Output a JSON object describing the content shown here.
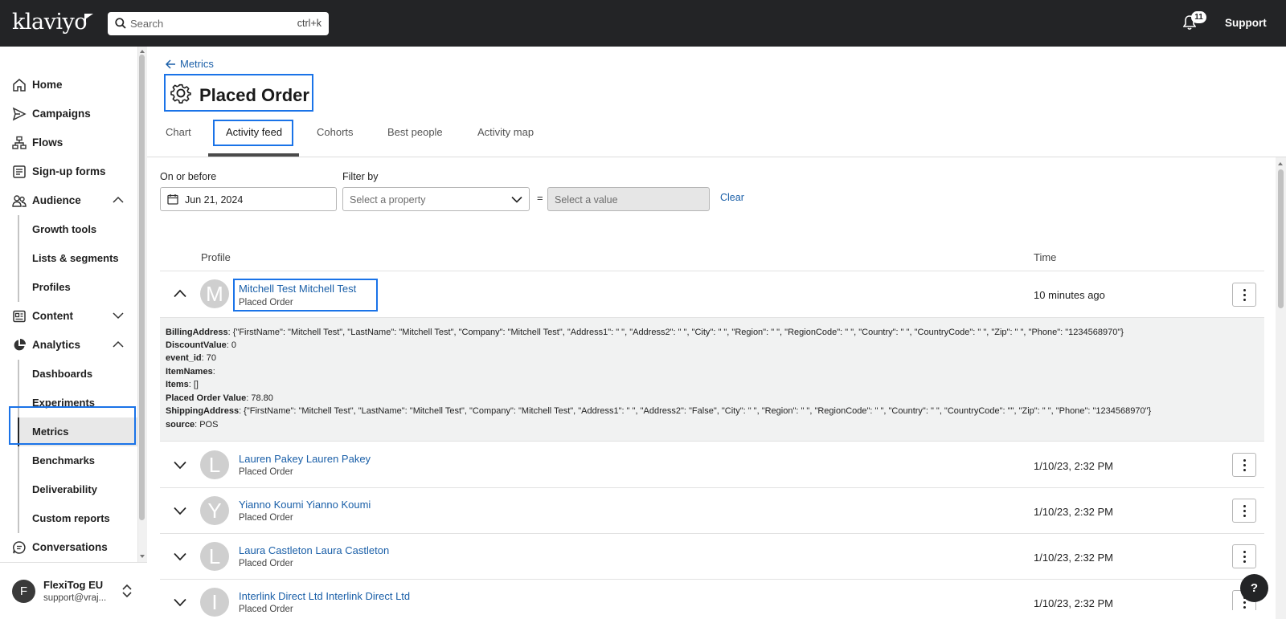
{
  "app": {
    "brand": "klaviyo"
  },
  "header": {
    "search_placeholder": "Search",
    "search_shortcut": "ctrl+k",
    "notification_count": "11",
    "support_label": "Support"
  },
  "sidebar": {
    "items": [
      {
        "label": "Home",
        "icon": "home-icon"
      },
      {
        "label": "Campaigns",
        "icon": "send-icon"
      },
      {
        "label": "Flows",
        "icon": "flow-icon"
      },
      {
        "label": "Sign-up forms",
        "icon": "form-icon"
      },
      {
        "label": "Audience",
        "icon": "people-icon",
        "expanded": true
      },
      {
        "label": "Content",
        "icon": "content-icon",
        "expanded": false
      },
      {
        "label": "Analytics",
        "icon": "pie-chart-icon",
        "expanded": true
      },
      {
        "label": "Conversations",
        "icon": "chat-icon"
      }
    ],
    "audience_sub": [
      "Growth tools",
      "Lists & segments",
      "Profiles"
    ],
    "analytics_sub": [
      "Dashboards",
      "Experiments",
      "Metrics",
      "Benchmarks",
      "Deliverability",
      "Custom reports"
    ],
    "active_sub": "Metrics",
    "user": {
      "initial": "F",
      "name": "FlexiTog EU",
      "email": "support@vraj..."
    }
  },
  "page": {
    "back_label": "Metrics",
    "title": "Placed Order",
    "tabs": [
      "Chart",
      "Activity feed",
      "Cohorts",
      "Best people",
      "Activity map"
    ],
    "active_tab": "Activity feed"
  },
  "filters": {
    "date_label": "On or before",
    "date_value": "Jun 21, 2024",
    "filter_label": "Filter by",
    "property_placeholder": "Select a property",
    "equals": "=",
    "value_placeholder": "Select a value",
    "clear_label": "Clear"
  },
  "table": {
    "headers": {
      "profile": "Profile",
      "time": "Time"
    },
    "rows": [
      {
        "initial": "M",
        "name": "Mitchell Test Mitchell Test",
        "event": "Placed Order",
        "time": "10 minutes ago",
        "expanded": true
      },
      {
        "initial": "L",
        "name": "Lauren Pakey Lauren Pakey",
        "event": "Placed Order",
        "time": "1/10/23, 2:32 PM",
        "expanded": false
      },
      {
        "initial": "Y",
        "name": "Yianno Koumi Yianno Koumi",
        "event": "Placed Order",
        "time": "1/10/23, 2:32 PM",
        "expanded": false
      },
      {
        "initial": "L",
        "name": "Laura Castleton Laura Castleton",
        "event": "Placed Order",
        "time": "1/10/23, 2:32 PM",
        "expanded": false
      },
      {
        "initial": "I",
        "name": "Interlink Direct Ltd Interlink Direct Ltd",
        "event": "Placed Order",
        "time": "1/10/23, 2:32 PM",
        "expanded": false
      }
    ],
    "details": [
      {
        "key": "BillingAddress",
        "value": ": {\"FirstName\": \"Mitchell Test\", \"LastName\": \"Mitchell Test\", \"Company\": \"Mitchell Test\", \"Address1\": \" \", \"Address2\": \" \", \"City\": \" \", \"Region\": \" \", \"RegionCode\": \" \", \"Country\": \" \", \"CountryCode\": \" \", \"Zip\": \" \", \"Phone\": \"1234568970\"}"
      },
      {
        "key": "DiscountValue",
        "value": ": 0"
      },
      {
        "key": "event_id",
        "value": ": 70"
      },
      {
        "key": "ItemNames",
        "value": ":"
      },
      {
        "key": "Items",
        "value": ": []"
      },
      {
        "key": "Placed Order Value",
        "value": ": 78.80"
      },
      {
        "key": "ShippingAddress",
        "value": ": {\"FirstName\": \"Mitchell Test\", \"LastName\": \"Mitchell Test\", \"Company\": \"Mitchell Test\", \"Address1\": \" \", \"Address2\": \"False\", \"City\": \" \", \"Region\": \" \", \"RegionCode\": \" \", \"Country\": \" \", \"CountryCode\": \"\", \"Zip\": \" \", \"Phone\": \"1234568970\"}"
      },
      {
        "key": "source",
        "value": ": POS"
      }
    ]
  },
  "help_label": "?",
  "colors": {
    "topbar": "#232426",
    "link": "#1a5fa8",
    "focus": "#1a73e8"
  }
}
